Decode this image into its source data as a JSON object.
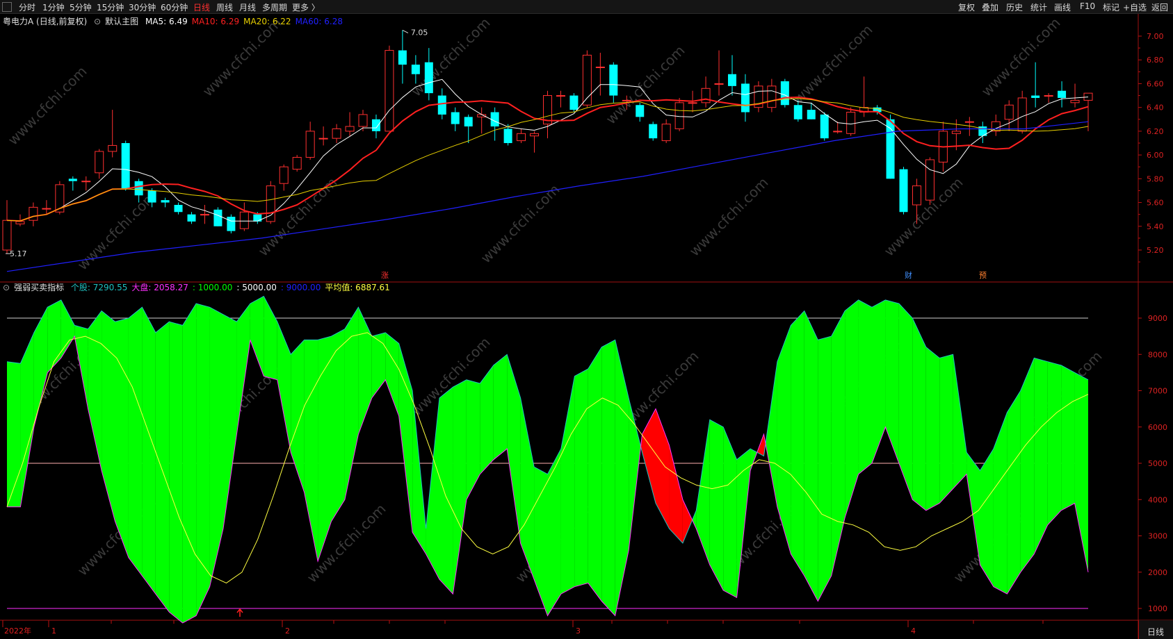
{
  "toolbar": {
    "left": [
      "分时",
      "1分钟",
      "5分钟",
      "15分钟",
      "30分钟",
      "60分钟",
      "日线",
      "周线",
      "月线",
      "多周期",
      "更多 〉"
    ],
    "active": "日线",
    "right": [
      "复权",
      "叠加",
      "历史",
      "统计",
      "画线",
      "F10",
      "标记",
      "+自选",
      "返回"
    ]
  },
  "main": {
    "stock_title": "粤电力A (日线,前复权)",
    "main_chart_label": "默认主图",
    "ma": [
      {
        "label": "MA5:",
        "value": "6.49",
        "color": "#ffffff"
      },
      {
        "label": "MA10:",
        "value": "6.29",
        "color": "#ff2020"
      },
      {
        "label": "MA20:",
        "value": "6.22",
        "color": "#e8d000"
      },
      {
        "label": "MA60:",
        "value": "6.28",
        "color": "#2020ff"
      }
    ],
    "high_mark": "7.05",
    "low_mark": "5.17",
    "events": [
      {
        "label": "涨",
        "color": "#ff3030"
      },
      {
        "label": "财",
        "color": "#4090ff"
      },
      {
        "label": "预",
        "color": "#ff8030"
      }
    ],
    "price_ticks": [
      "7.00",
      "6.80",
      "6.60",
      "6.40",
      "6.20",
      "6.00",
      "5.80",
      "5.60",
      "5.40",
      "5.20"
    ]
  },
  "sub": {
    "title": "强弱买卖指标",
    "items": [
      {
        "label": "个股:",
        "value": "7290.55",
        "color": "#20c0c0"
      },
      {
        "label": "大盘:",
        "value": "2058.27",
        "color": "#ff30ff"
      },
      {
        "label": ":",
        "value": "1000.00",
        "color": "#00ff00"
      },
      {
        "label": ":",
        "value": "5000.00",
        "color": "#ffffff"
      },
      {
        "label": ":",
        "value": "9000.00",
        "color": "#2020ff"
      },
      {
        "label": "平均值:",
        "value": "6887.61",
        "color": "#ffff40"
      }
    ],
    "ticks": [
      "9000",
      "8000",
      "7000",
      "6000",
      "5000",
      "4000",
      "3000",
      "2000",
      "1000"
    ]
  },
  "x_axis": {
    "labels": [
      "2022年",
      "1",
      "2",
      "3",
      "4"
    ],
    "period": "日线"
  },
  "watermark": "www.cfchi.com",
  "chart_data": {
    "type": "candlestick",
    "title": "粤电力A (日线,前复权)",
    "ylim": [
      5.1,
      7.1
    ],
    "up_color": "#ff3030",
    "down_color": "#00ffff",
    "candles": [
      [
        5.2,
        5.45,
        5.17,
        5.62
      ],
      [
        5.42,
        5.44,
        5.4,
        5.5
      ],
      [
        5.45,
        5.56,
        5.4,
        5.6
      ],
      [
        5.55,
        5.55,
        5.5,
        5.62
      ],
      [
        5.52,
        5.75,
        5.5,
        5.78
      ],
      [
        5.8,
        5.78,
        5.7,
        5.82
      ],
      [
        5.78,
        5.78,
        5.7,
        5.82
      ],
      [
        5.85,
        6.03,
        5.8,
        6.05
      ],
      [
        6.03,
        6.08,
        5.98,
        6.38
      ],
      [
        6.1,
        5.72,
        5.7,
        6.12
      ],
      [
        5.78,
        5.66,
        5.6,
        5.8
      ],
      [
        5.7,
        5.6,
        5.56,
        5.72
      ],
      [
        5.62,
        5.6,
        5.56,
        5.64
      ],
      [
        5.58,
        5.52,
        5.5,
        5.6
      ],
      [
        5.5,
        5.44,
        5.42,
        5.52
      ],
      [
        5.5,
        5.5,
        5.42,
        5.58
      ],
      [
        5.54,
        5.4,
        5.4,
        5.56
      ],
      [
        5.48,
        5.36,
        5.34,
        5.5
      ],
      [
        5.38,
        5.52,
        5.36,
        5.6
      ],
      [
        5.5,
        5.44,
        5.42,
        5.52
      ],
      [
        5.44,
        5.74,
        5.42,
        5.78
      ],
      [
        5.76,
        5.9,
        5.7,
        5.92
      ],
      [
        5.88,
        5.98,
        5.86,
        6.0
      ],
      [
        5.98,
        6.2,
        5.96,
        6.28
      ],
      [
        6.14,
        6.14,
        6.08,
        6.24
      ],
      [
        6.14,
        6.22,
        6.1,
        6.26
      ],
      [
        6.2,
        6.24,
        6.16,
        6.36
      ],
      [
        6.24,
        6.34,
        6.2,
        6.38
      ],
      [
        6.3,
        6.2,
        6.14,
        6.34
      ],
      [
        6.2,
        6.88,
        6.2,
        6.92
      ],
      [
        6.88,
        6.76,
        6.6,
        7.05
      ],
      [
        6.76,
        6.68,
        6.6,
        6.84
      ],
      [
        6.78,
        6.52,
        6.46,
        6.9
      ],
      [
        6.5,
        6.34,
        6.3,
        6.56
      ],
      [
        6.36,
        6.26,
        6.2,
        6.4
      ],
      [
        6.32,
        6.24,
        6.1,
        6.34
      ],
      [
        6.32,
        6.34,
        6.18,
        6.4
      ],
      [
        6.36,
        6.24,
        6.12,
        6.4
      ],
      [
        6.22,
        6.1,
        6.08,
        6.26
      ],
      [
        6.12,
        6.18,
        6.1,
        6.22
      ],
      [
        6.16,
        6.18,
        6.02,
        6.2
      ],
      [
        6.26,
        6.5,
        6.14,
        6.54
      ],
      [
        6.5,
        6.5,
        6.4,
        6.54
      ],
      [
        6.5,
        6.38,
        6.36,
        6.52
      ],
      [
        6.42,
        6.84,
        6.4,
        6.88
      ],
      [
        6.74,
        6.74,
        6.5,
        6.86
      ],
      [
        6.76,
        6.5,
        6.44,
        6.78
      ],
      [
        6.46,
        6.46,
        6.38,
        6.5
      ],
      [
        6.42,
        6.32,
        6.28,
        6.44
      ],
      [
        6.26,
        6.14,
        6.12,
        6.28
      ],
      [
        6.12,
        6.26,
        6.1,
        6.3
      ],
      [
        6.22,
        6.44,
        6.2,
        6.48
      ],
      [
        6.44,
        6.44,
        6.36,
        6.54
      ],
      [
        6.44,
        6.56,
        6.4,
        6.66
      ],
      [
        6.6,
        6.6,
        6.5,
        6.88
      ],
      [
        6.68,
        6.58,
        6.5,
        6.84
      ],
      [
        6.6,
        6.36,
        6.28,
        6.68
      ],
      [
        6.4,
        6.58,
        6.36,
        6.62
      ],
      [
        6.4,
        6.58,
        6.36,
        6.64
      ],
      [
        6.62,
        6.42,
        6.4,
        6.64
      ],
      [
        6.42,
        6.3,
        6.28,
        6.46
      ],
      [
        6.38,
        6.3,
        6.3,
        6.44
      ],
      [
        6.34,
        6.14,
        6.12,
        6.36
      ],
      [
        6.2,
        6.2,
        6.18,
        6.28
      ],
      [
        6.18,
        6.36,
        6.16,
        6.4
      ],
      [
        6.36,
        6.4,
        6.32,
        6.66
      ],
      [
        6.4,
        6.36,
        6.34,
        6.42
      ],
      [
        6.3,
        5.8,
        5.8,
        6.34
      ],
      [
        5.88,
        5.52,
        5.5,
        5.9
      ],
      [
        5.58,
        5.74,
        5.42,
        5.8
      ],
      [
        5.62,
        5.96,
        5.58,
        5.98
      ],
      [
        5.94,
        6.2,
        5.86,
        6.28
      ],
      [
        6.18,
        6.2,
        6.04,
        6.3
      ],
      [
        6.28,
        6.28,
        6.16,
        6.32
      ],
      [
        6.24,
        6.16,
        6.1,
        6.28
      ],
      [
        6.2,
        6.28,
        6.16,
        6.34
      ],
      [
        6.3,
        6.42,
        6.2,
        6.46
      ],
      [
        6.2,
        6.48,
        6.18,
        6.54
      ],
      [
        6.5,
        6.48,
        6.4,
        6.78
      ],
      [
        6.5,
        6.5,
        6.44,
        6.52
      ],
      [
        6.54,
        6.48,
        6.4,
        6.62
      ],
      [
        6.44,
        6.46,
        6.4,
        6.6
      ],
      [
        6.46,
        6.52,
        6.2,
        6.52
      ]
    ]
  }
}
